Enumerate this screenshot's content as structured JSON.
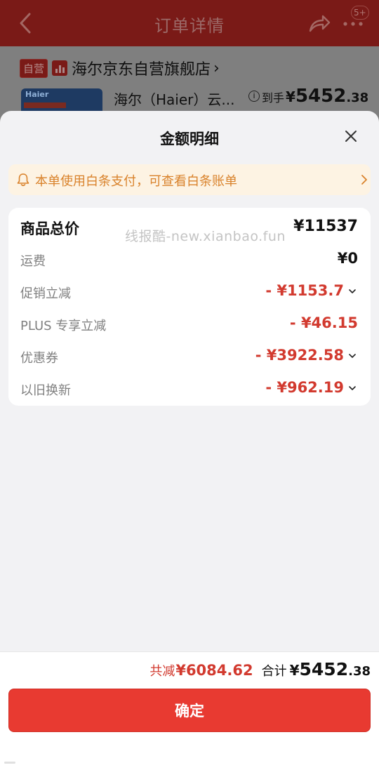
{
  "header": {
    "title": "订单详情",
    "badge": "5+"
  },
  "store": {
    "self_tag": "自营",
    "name": "海尔京东自营旗舰店",
    "arrow": "›"
  },
  "product": {
    "thumb_brand": "Haier",
    "name": "海尔（Haier）云...",
    "price_label": "到手",
    "currency": "¥",
    "price_int": "5452",
    "price_dec": ".38"
  },
  "sheet": {
    "title": "金额明细",
    "notice": "本单使用白条支付，可查看白条账单",
    "watermark": "线报酷-new.xianbao.fun",
    "rows": [
      {
        "label": "商品总价",
        "value": "¥11537"
      },
      {
        "label": "运费",
        "value": "¥0"
      },
      {
        "label": "促销立减",
        "value": "- ¥1153.7"
      },
      {
        "label": "PLUS 专享立减",
        "value": "- ¥46.15"
      },
      {
        "label": "优惠券",
        "value": "- ¥3922.58"
      },
      {
        "label": "以旧换新",
        "value": "- ¥962.19"
      }
    ]
  },
  "bottom": {
    "discount_label": "共减",
    "discount_value": "¥6084.62",
    "total_label": "合计",
    "total_currency": "¥",
    "total_int": "5452",
    "total_dec": ".38",
    "confirm_label": "确定"
  },
  "colors": {
    "accent_red": "#e83a31",
    "discount_red": "#d23a2f",
    "notice_orange": "#d9822b",
    "notice_bg": "#fdf3e3"
  },
  "icons": {
    "back": "back-arrow-icon",
    "share": "share-icon",
    "more": "more-icon",
    "close": "close-icon",
    "bell": "bell-icon",
    "chevron_right": "chevron-right-icon",
    "chevron_down": "chevron-down-icon",
    "info": "info-icon"
  }
}
